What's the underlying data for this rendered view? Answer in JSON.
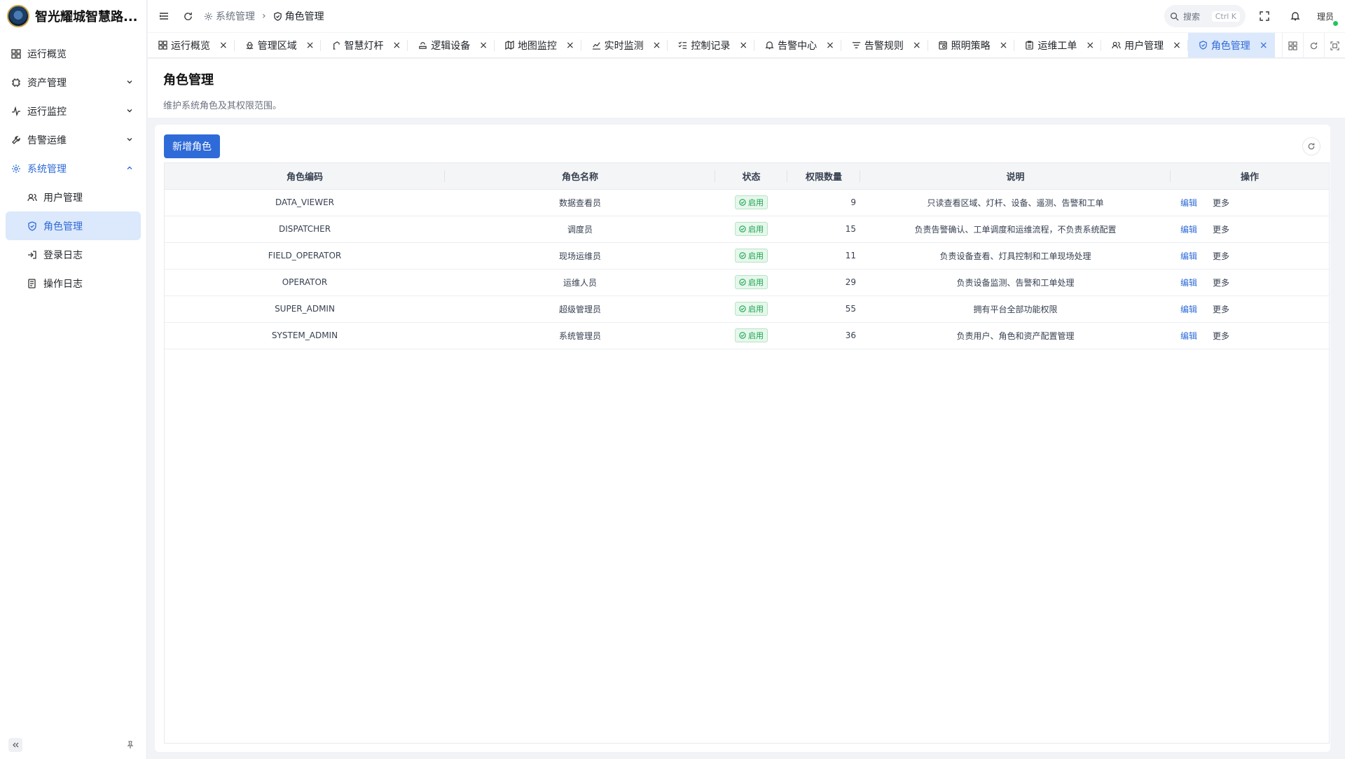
{
  "app": {
    "title": "智光耀城智慧路..."
  },
  "sidebar": {
    "items": [
      {
        "label": "运行概览",
        "icon": "dashboard-icon",
        "expandable": false
      },
      {
        "label": "资产管理",
        "icon": "chip-icon",
        "expandable": true
      },
      {
        "label": "运行监控",
        "icon": "activity-icon",
        "expandable": true
      },
      {
        "label": "告警运维",
        "icon": "wrench-icon",
        "expandable": true
      },
      {
        "label": "系统管理",
        "icon": "gear-icon",
        "expandable": true,
        "expanded": true
      }
    ],
    "sub_items": [
      {
        "label": "用户管理",
        "icon": "users-icon"
      },
      {
        "label": "角色管理",
        "icon": "shield-icon",
        "active": true
      },
      {
        "label": "登录日志",
        "icon": "login-icon"
      },
      {
        "label": "操作日志",
        "icon": "log-icon"
      }
    ]
  },
  "header": {
    "breadcrumb": [
      "系统管理",
      "角色管理"
    ],
    "search_placeholder": "搜索",
    "search_shortcut": "Ctrl K",
    "user": "理员"
  },
  "tabs": [
    {
      "label": "运行概览"
    },
    {
      "label": "管理区域"
    },
    {
      "label": "智慧灯杆"
    },
    {
      "label": "逻辑设备"
    },
    {
      "label": "地图监控"
    },
    {
      "label": "实时监测"
    },
    {
      "label": "控制记录"
    },
    {
      "label": "告警中心"
    },
    {
      "label": "告警规则"
    },
    {
      "label": "照明策略"
    },
    {
      "label": "运维工单"
    },
    {
      "label": "用户管理"
    },
    {
      "label": "角色管理",
      "active": true
    }
  ],
  "page": {
    "title": "角色管理",
    "description": "维护系统角色及其权限范围。",
    "add_button": "新增角色"
  },
  "table": {
    "columns": [
      "角色编码",
      "角色名称",
      "状态",
      "权限数量",
      "说明",
      "操作"
    ],
    "rows": [
      {
        "code": "DATA_VIEWER",
        "name": "数据查看员",
        "status": "启用",
        "perm_count": "9",
        "desc": "只读查看区域、灯杆、设备、遥测、告警和工单",
        "edit": "编辑",
        "more": "更多"
      },
      {
        "code": "DISPATCHER",
        "name": "调度员",
        "status": "启用",
        "perm_count": "15",
        "desc": "负责告警确认、工单调度和运维流程，不负责系统配置",
        "edit": "编辑",
        "more": "更多"
      },
      {
        "code": "FIELD_OPERATOR",
        "name": "现场运维员",
        "status": "启用",
        "perm_count": "11",
        "desc": "负责设备查看、灯具控制和工单现场处理",
        "edit": "编辑",
        "more": "更多"
      },
      {
        "code": "OPERATOR",
        "name": "运维人员",
        "status": "启用",
        "perm_count": "29",
        "desc": "负责设备监测、告警和工单处理",
        "edit": "编辑",
        "more": "更多"
      },
      {
        "code": "SUPER_ADMIN",
        "name": "超级管理员",
        "status": "启用",
        "perm_count": "55",
        "desc": "拥有平台全部功能权限",
        "edit": "编辑",
        "more": "更多"
      },
      {
        "code": "SYSTEM_ADMIN",
        "name": "系统管理员",
        "status": "启用",
        "perm_count": "36",
        "desc": "负责用户、角色和资产配置管理",
        "edit": "编辑",
        "more": "更多"
      }
    ]
  },
  "colors": {
    "primary": "#2f6bd8",
    "active_bg": "#dce8fb",
    "success": "#16a34a"
  }
}
